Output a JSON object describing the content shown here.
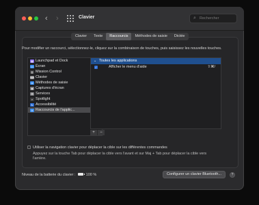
{
  "window": {
    "title": "Clavier"
  },
  "search": {
    "placeholder": "Rechercher"
  },
  "tabs": [
    {
      "label": "Clavier",
      "active": false
    },
    {
      "label": "Texte",
      "active": false
    },
    {
      "label": "Raccourcis",
      "active": true
    },
    {
      "label": "Méthodes de saisie",
      "active": false
    },
    {
      "label": "Dictée",
      "active": false
    }
  ],
  "description": "Pour modifier un raccourci, sélectionnez-le, cliquez sur la combinaison de touches, puis saisissez les nouvelles touches.",
  "categories": [
    {
      "label": "Launchpad et Dock",
      "icon": "launchpad-icon",
      "glyph": "▦",
      "color": "#8a6df0"
    },
    {
      "label": "Écran",
      "icon": "display-icon",
      "glyph": "▭",
      "color": "#3a8ef0"
    },
    {
      "label": "Mission Control",
      "icon": "mission-control-icon",
      "glyph": "▥",
      "color": "#3a3a3c"
    },
    {
      "label": "Clavier",
      "icon": "keyboard-icon",
      "glyph": "⌨",
      "color": "#7a7a7e"
    },
    {
      "label": "Méthodes de saisie",
      "icon": "input-methods-icon",
      "glyph": "A",
      "color": "#3a8ef0"
    },
    {
      "label": "Captures d'écran",
      "icon": "screenshot-icon",
      "glyph": "◉",
      "color": "#7a7a7e"
    },
    {
      "label": "Services",
      "icon": "services-icon",
      "glyph": "⚙",
      "color": "#7a7a7e"
    },
    {
      "label": "Spotlight",
      "icon": "spotlight-icon",
      "glyph": "⌕",
      "color": "#3a3a3c"
    },
    {
      "label": "Accessibilité",
      "icon": "accessibility-icon",
      "glyph": "♿",
      "color": "#2f6fd6"
    },
    {
      "label": "Raccourcis de l'applic...",
      "icon": "app-shortcuts-icon",
      "glyph": "A",
      "color": "#3a8ef0",
      "selected": true
    }
  ],
  "shortcuts": {
    "group_label": "Toutes les applications",
    "items": [
      {
        "label": "Afficher le menu d'aide",
        "keys": "⇧⌘/",
        "checked": true
      }
    ]
  },
  "controls": {
    "add": "+",
    "remove": "−"
  },
  "keyboard_nav": {
    "label": "Utiliser la navigation clavier pour déplacer la cible sur les différentes commandes",
    "help": "Appuyez sur la touche Tab pour déplacer la cible vers l'avant et sur Maj + Tab pour déplacer la cible vers l'arrière."
  },
  "battery": {
    "label": "Niveau de la batterie du clavier :",
    "value": "100 %"
  },
  "bluetooth_button": "Configurer un clavier Bluetooth...",
  "help_button": "?"
}
